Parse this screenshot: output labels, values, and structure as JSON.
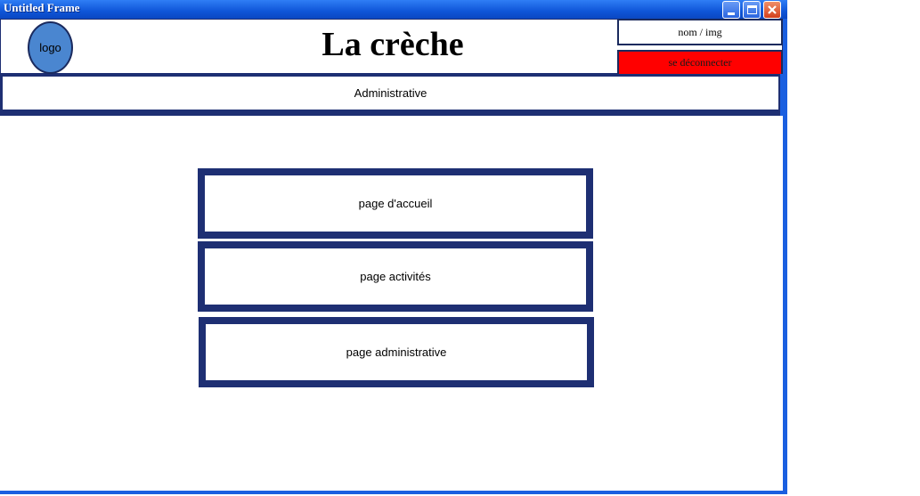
{
  "window": {
    "title": "Untitled Frame"
  },
  "header": {
    "logo_label": "logo",
    "site_title": "La crèche",
    "user_label": "nom / img",
    "logout_label": "se déconnecter"
  },
  "nav": {
    "section_label": "Administrative"
  },
  "pages": [
    {
      "label": "page d'accueil"
    },
    {
      "label": "page activités"
    },
    {
      "label": "page administrative"
    }
  ],
  "colors": {
    "titlebar": "#0f55d8",
    "border_navy": "#1e2f73",
    "logo_fill": "#4a86d0",
    "logout_fill": "#ff0000"
  }
}
